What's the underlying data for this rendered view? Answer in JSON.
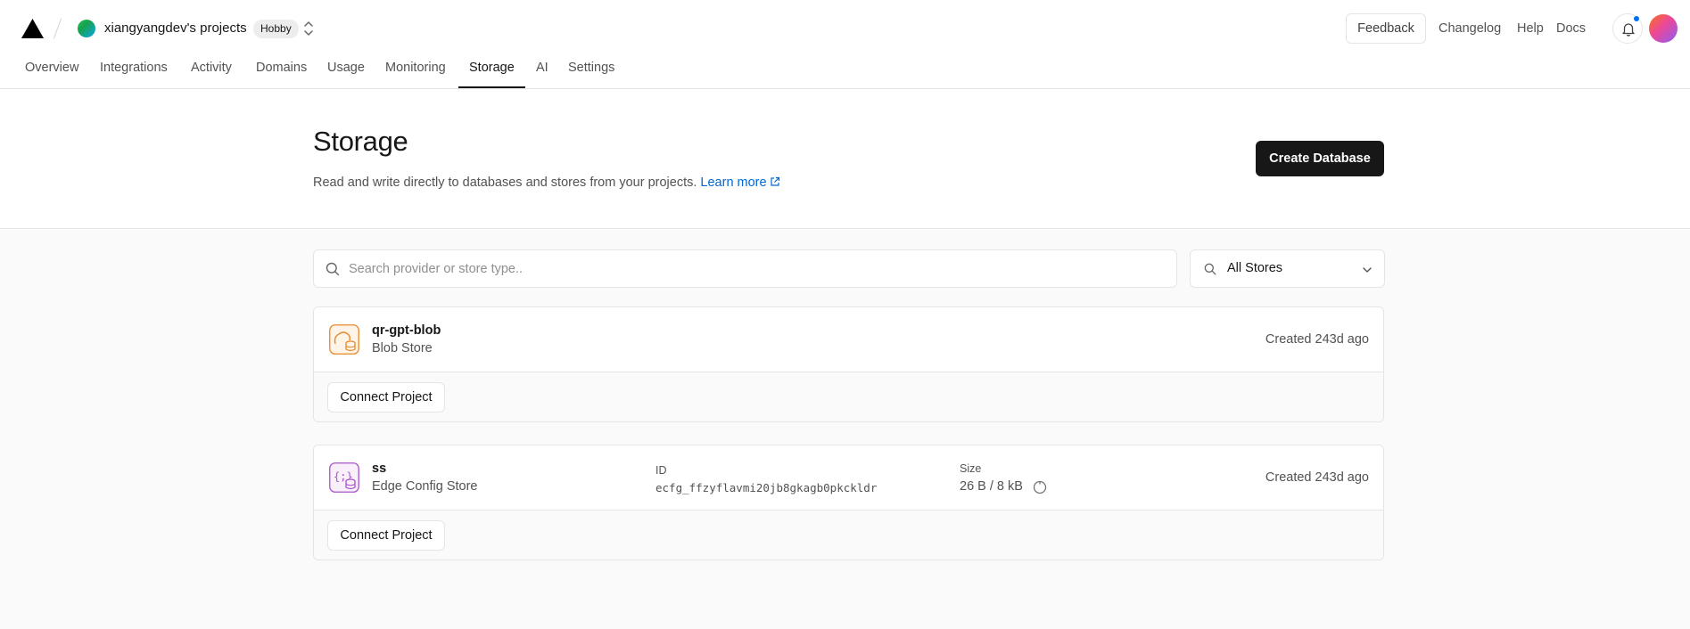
{
  "header": {
    "team_name": "xiangyangdev's projects",
    "plan_badge": "Hobby",
    "feedback_label": "Feedback",
    "links": [
      "Changelog",
      "Help",
      "Docs"
    ]
  },
  "tabs": [
    {
      "label": "Overview"
    },
    {
      "label": "Integrations"
    },
    {
      "label": "Activity"
    },
    {
      "label": "Domains"
    },
    {
      "label": "Usage"
    },
    {
      "label": "Monitoring"
    },
    {
      "label": "Storage",
      "active": true
    },
    {
      "label": "AI"
    },
    {
      "label": "Settings"
    }
  ],
  "page": {
    "title": "Storage",
    "description": "Read and write directly to databases and stores from your projects.",
    "learn_more": "Learn more",
    "create_button": "Create Database"
  },
  "filters": {
    "search_placeholder": "Search provider or store type..",
    "store_filter": "All Stores"
  },
  "stores": [
    {
      "name": "qr-gpt-blob",
      "type": "Blob Store",
      "created": "Created 243d ago",
      "connect_label": "Connect Project",
      "icon": "blob-store-icon",
      "accent": "#e8892b"
    },
    {
      "name": "ss",
      "type": "Edge Config Store",
      "id_label": "ID",
      "id": "ecfg_ffzyflavmi20jb8gkagb0pkckldr",
      "size_label": "Size",
      "size": "26 B / 8 kB",
      "usage_fraction": 0.003,
      "created": "Created 243d ago",
      "connect_label": "Connect Project",
      "icon": "edge-config-icon",
      "accent": "#a855c7"
    }
  ],
  "colors": {
    "primary_button": "#171717",
    "link": "#0068d6",
    "notification_dot": "#0070f3"
  }
}
